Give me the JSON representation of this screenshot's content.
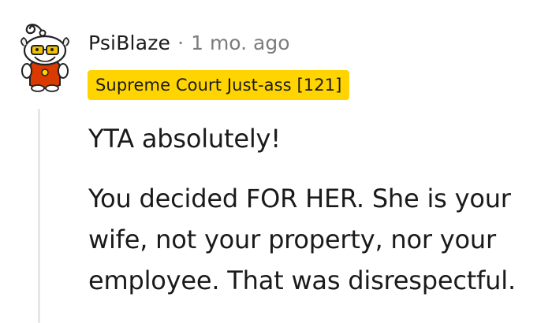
{
  "comment": {
    "author": "PsiBlaze",
    "separator": "·",
    "timestamp": "1 mo. ago",
    "flair": "Supreme Court Just-ass [121]",
    "paragraphs": [
      "YTA absolutely!",
      "You decided FOR HER. She is your wife, not your property, nor your employee. That was disrespectful."
    ]
  },
  "colors": {
    "flair_background": "#ffd400",
    "thread_line": "#e4e6e8",
    "muted_text": "#7c7c7c"
  },
  "icons": {
    "avatar": "snoo-avatar-with-glasses"
  }
}
